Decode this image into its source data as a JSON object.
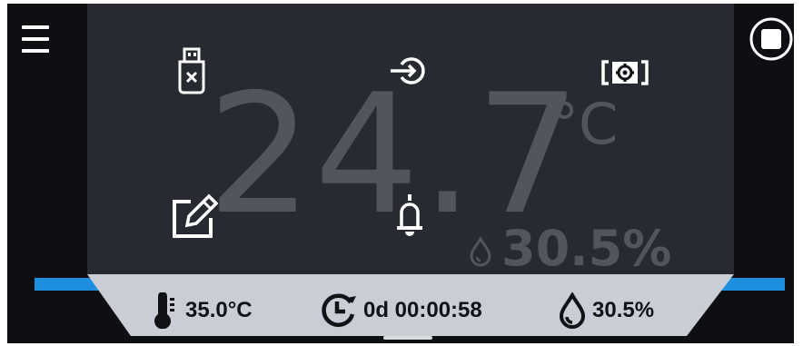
{
  "display": {
    "temperature_value": "24.7",
    "temperature_unit": "°C",
    "humidity_value": "30.5%"
  },
  "status_bar": {
    "setpoint_temperature": "35.0°C",
    "elapsed_time": "0d 00:00:58",
    "setpoint_humidity": "30.5%"
  },
  "icons": {
    "menu": "menu-icon",
    "stop": "stop-icon",
    "usb": "usb-disconnected-icon",
    "login": "login-icon",
    "camera": "camera-settings-icon",
    "edit": "edit-icon",
    "alarm": "bell-icon"
  },
  "colors": {
    "background": "#0e0f13",
    "panel": "#272a30",
    "big_text": "#52555b",
    "accent_blue": "#1d8fde",
    "status_bar": "#c8cdd6"
  }
}
